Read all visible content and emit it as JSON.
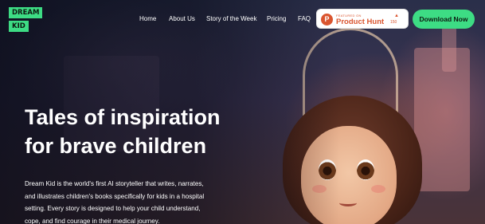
{
  "brand": {
    "logo_line1": "DREAM",
    "logo_line2": "KID"
  },
  "nav": {
    "items": [
      {
        "label": "Home"
      },
      {
        "label": "About Us"
      },
      {
        "label": "Story of the Week"
      },
      {
        "label": "Pricing"
      },
      {
        "label": "FAQ"
      }
    ]
  },
  "product_hunt": {
    "small_label": "FEATURED ON",
    "name": "Product Hunt",
    "upvote_count": "150",
    "color": "#da552f"
  },
  "cta": {
    "download_label": "Download Now",
    "color": "#3ddc84"
  },
  "hero": {
    "headline_line1": "Tales of inspiration",
    "headline_line2": "for brave children",
    "description_lines": [
      "Dream Kid is the world's first AI storyteller that writes, narrates,",
      "and illustrates children's books specifically for kids in a hospital",
      "setting. Every story is designed to help your child understand,",
      "cope, and find courage in their medical journey."
    ]
  }
}
